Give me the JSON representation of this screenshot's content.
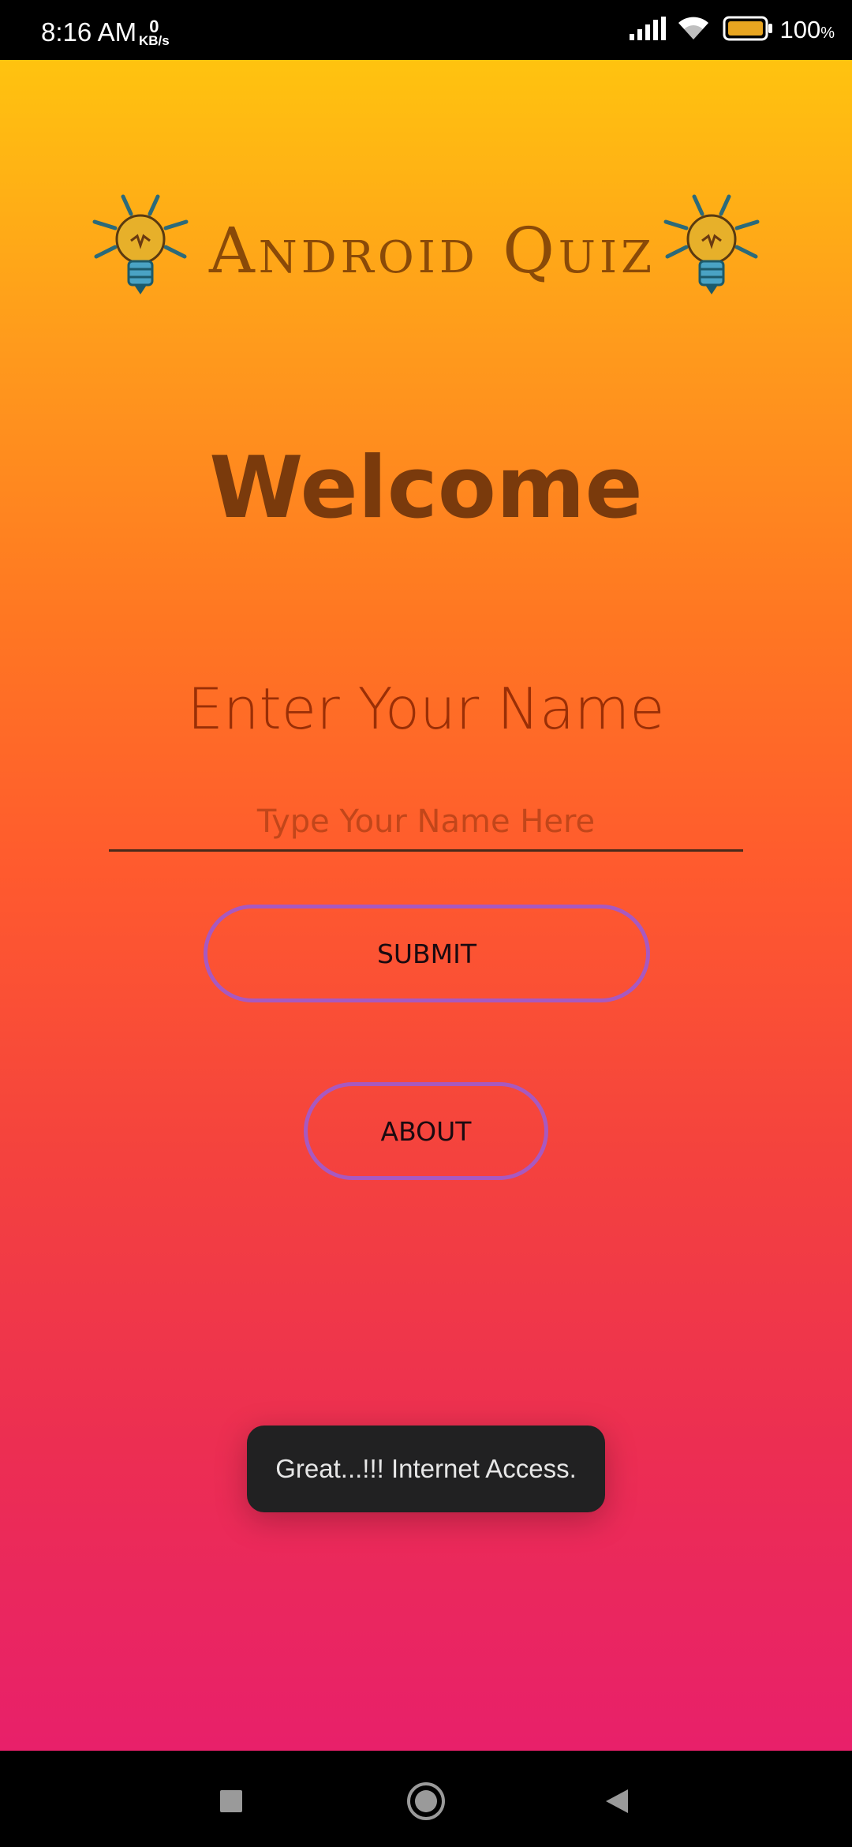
{
  "status_bar": {
    "time": "8:16 AM",
    "net_speed_value": "0",
    "net_speed_unit": "KB/s",
    "battery_percent": "100",
    "battery_unit": "%"
  },
  "app": {
    "title": "Android Quiz",
    "welcome": "Welcome",
    "enter_name_label": "Enter Your Name",
    "name_input": {
      "value": "",
      "placeholder": "Type Your Name Here"
    },
    "submit_label": "SUBMIT",
    "about_label": "ABOUT"
  },
  "toast": {
    "message": "Great...!!! Internet Access."
  },
  "colors": {
    "gradient_top": "#ffc30f",
    "gradient_bottom": "#e8206a",
    "button_border": "#a859c0",
    "title_color": "#8a4a08",
    "welcome_color": "#7a3a0c"
  },
  "icons": {
    "left_decoration": "lightbulb-icon",
    "right_decoration": "lightbulb-icon",
    "status": [
      "signal-icon",
      "wifi-icon",
      "battery-icon"
    ],
    "nav": [
      "recents-icon",
      "home-icon",
      "back-icon"
    ]
  }
}
